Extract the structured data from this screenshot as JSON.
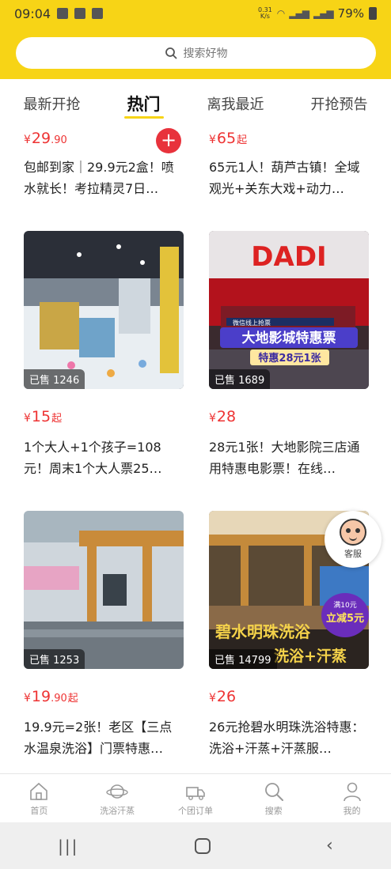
{
  "status_bar": {
    "time": "09:04",
    "net_speed_top": "0.31",
    "net_speed_bottom": "K/s",
    "battery": "79%"
  },
  "search": {
    "placeholder": "搜索好物"
  },
  "tabs": [
    {
      "label": "最新开抢"
    },
    {
      "label": "热门"
    },
    {
      "label": "离我最近"
    },
    {
      "label": "开抢预告"
    }
  ],
  "active_tab": "热门",
  "products": [
    {
      "price_int": "29",
      "price_dec": ".90",
      "price_suffix": "",
      "title": "包邮到家｜29.9元2盒！喷水就长！考拉精灵7日…"
    },
    {
      "price_int": "65",
      "price_dec": "",
      "price_suffix": "起",
      "title": "65元1人！葫芦古镇！全域观光+关东大戏+动力…"
    },
    {
      "sold": "已售 1246",
      "price_int": "15",
      "price_dec": "",
      "price_suffix": "起",
      "title": "1个大人+1个孩子=108元！周末1个大人票25…"
    },
    {
      "sold": "已售 1689",
      "image_text": {
        "top": "DADI",
        "promo": "大地影城特惠票",
        "sub": "特惠28元1张",
        "small": "微信线上抢票"
      },
      "price_int": "28",
      "price_dec": "",
      "price_suffix": "",
      "title": "28元1张！大地影院三店通用特惠电影票！在线…"
    },
    {
      "sold": "已售 1253",
      "price_int": "19",
      "price_dec": ".90",
      "price_suffix": "起",
      "title": "19.9元=2张！老区【三点水温泉洗浴】门票特惠…"
    },
    {
      "sold": "已售 14799",
      "image_text": {
        "main": "碧水明珠洗浴",
        "sub": "洗浴+汗蒸",
        "badge_top": "满10元",
        "badge_main": "立减5元"
      },
      "price_int": "26",
      "price_dec": "",
      "price_suffix": "",
      "title": "26元抢碧水明珠洗浴特惠：洗浴+汗蒸+汗蒸服…"
    }
  ],
  "currency_symbol": "¥",
  "customer_service": {
    "label": "客服"
  },
  "bottom_nav": [
    {
      "label": "首页",
      "icon": "home-icon"
    },
    {
      "label": "洗浴汗蒸",
      "icon": "planet-icon"
    },
    {
      "label": "个团订单",
      "icon": "truck-icon"
    },
    {
      "label": "搜索",
      "icon": "search-icon"
    },
    {
      "label": "我的",
      "icon": "user-icon"
    }
  ],
  "colors": {
    "brand_yellow": "#f7d416",
    "price_red": "#e33333",
    "add_button": "#e8323c"
  }
}
